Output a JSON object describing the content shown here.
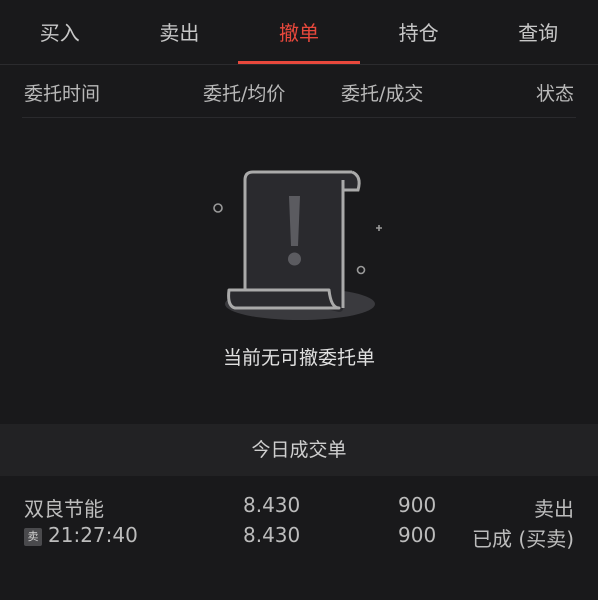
{
  "tabs": [
    {
      "label": "买入"
    },
    {
      "label": "卖出"
    },
    {
      "label": "撤单"
    },
    {
      "label": "持仓"
    },
    {
      "label": "查询"
    }
  ],
  "active_tab": "撤单",
  "accent_color": "#e8483c",
  "columns": {
    "time": "委托时间",
    "price": "委托/均价",
    "qty": "委托/成交",
    "status": "状态"
  },
  "empty_state": {
    "icon": "document-exclamation-icon",
    "message": "当前无可撤委托单"
  },
  "today_section": {
    "title": "今日成交单"
  },
  "trades": [
    {
      "name": "双良节能",
      "side_badge": "卖",
      "time": "21:27:40",
      "order_price": "8.430",
      "avg_price": "8.430",
      "order_qty": "900",
      "filled_qty": "900",
      "direction": "卖出",
      "status": "已成 (买卖)"
    }
  ]
}
